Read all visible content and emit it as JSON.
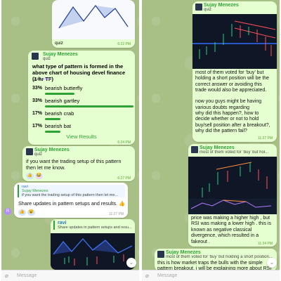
{
  "left": {
    "top_caption": "quiz",
    "top_time": "6:22 PM",
    "poll": {
      "sender": "Sujay Menezes",
      "reply_label": "quiz",
      "question": "what type of pattern is formed in the above chart of housing devel finance (1 hr TF)",
      "meta": "Quiz",
      "options": [
        {
          "pct": "33%",
          "label": "bearish butterfly",
          "fraction": 0.33
        },
        {
          "pct": "33%",
          "label": "bearish gartley",
          "fraction": 0.33,
          "selected": true
        },
        {
          "pct": "17%",
          "label": "bearish crab",
          "fraction": 0.17
        },
        {
          "pct": "17%",
          "label": "bearish bat",
          "fraction": 0.17
        }
      ],
      "view_results": "View Results",
      "time": "6:24 PM"
    },
    "msg2": {
      "sender": "Sujay Menezes",
      "reply_label": "quiz",
      "text": "if you want the trading setup of this pattern then let me know.",
      "time": "6:27 PM",
      "reactions": [
        "👍",
        "😂"
      ]
    },
    "msg3": {
      "quote_name": "ravi",
      "quote_sender": "Sujay Menezes",
      "quote_text": "if you want the trading setup of this pattern then let me...",
      "text": "Share updates in pattern setups and results. 👍",
      "time": "11:27 PM",
      "avatar": "R",
      "reactions": [
        "👍",
        "😮"
      ]
    },
    "msg4": {
      "sender": "ravi",
      "text": "Share updates in pattern setups and resu..."
    },
    "input_placeholder": "Message"
  },
  "right": {
    "msg1": {
      "sender": "Sujay Menezes",
      "reply_label": "quiz",
      "text": "most of them voted for ‘buy’ but holding a short position will be the correct answer or avoiding this trade would also be appreciated.\n\nnow you guys might be having various doubts regarding\nwhy did this happen?, how to decide whether or not to hold buy/sell position after a breakout?, why did the pattern fail?",
      "time": "11:27 PM"
    },
    "msg2": {
      "sender": "Sujay Menezes",
      "reply_label": "most of them voted for ‘buy’ but hol...",
      "text": "price was making a higher high , but RSI was making a lower high . this is known as negative classical divergence, which resulted in a fakeout .",
      "time": "11:34 PM"
    },
    "msg3": {
      "sender": "Sujay Menezes",
      "reply_label": "most of them voted for ‘buy’ but holding a short position...",
      "text": "this is how market traps the bulls with the simple pattern breakout. i will be explaining more about RSI"
    },
    "input_placeholder": "Message"
  }
}
